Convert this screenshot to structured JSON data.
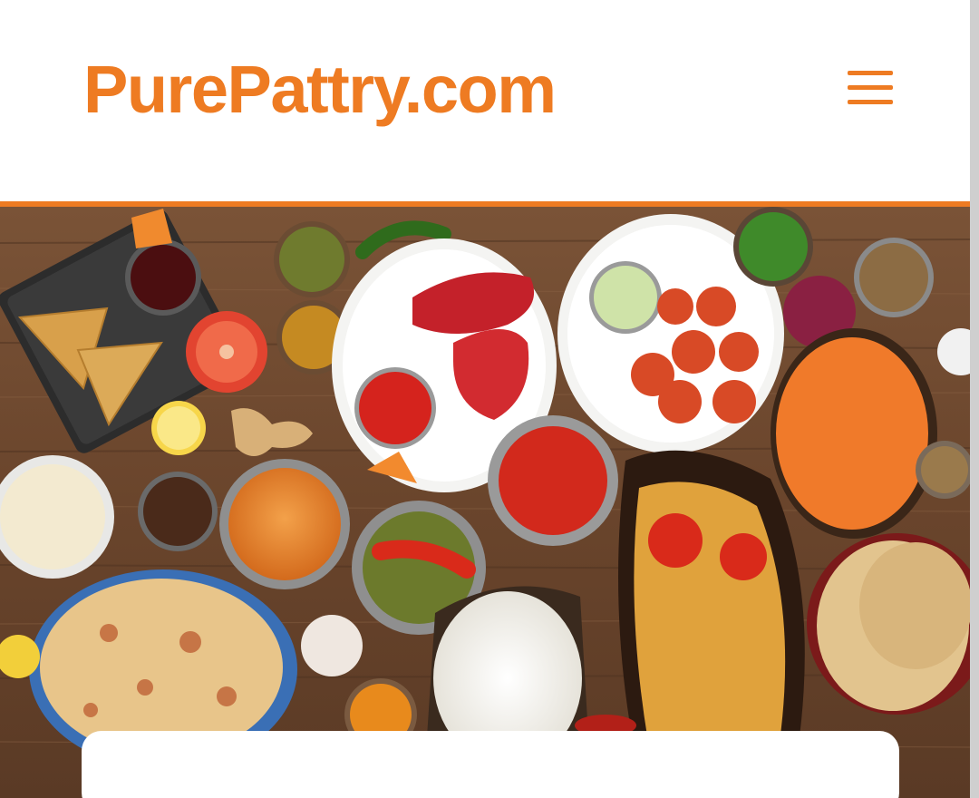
{
  "header": {
    "logo_text": "PurePattry.com",
    "menu_icon": "hamburger-menu-icon"
  },
  "colors": {
    "brand": "#ee7b22",
    "table": "#6b4a33"
  },
  "hero": {
    "image": "food-spread-image"
  }
}
